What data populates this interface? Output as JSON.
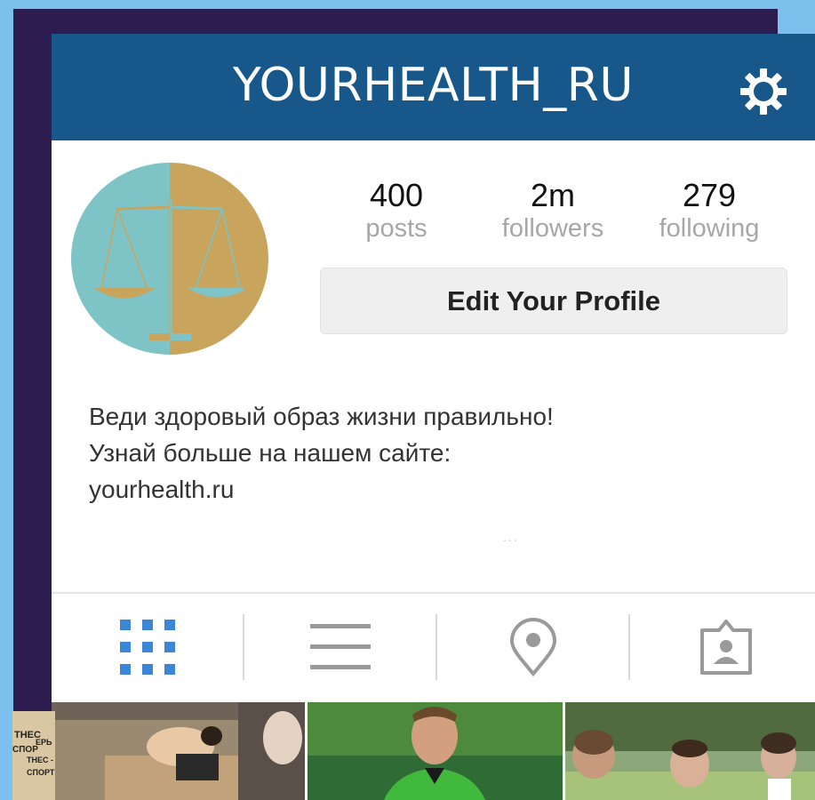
{
  "header": {
    "username": "YOURHEALTH_RU",
    "settings_icon": "gear-icon",
    "bar_color": "#17578a"
  },
  "profile": {
    "avatar_icon": "scales-of-justice-icon",
    "stats": [
      {
        "value": "400",
        "label": "posts"
      },
      {
        "value": "2m",
        "label": "followers"
      },
      {
        "value": "279",
        "label": "following"
      }
    ],
    "edit_button_label": "Edit Your Profile",
    "bio_lines": [
      "Веди здоровый образ жизни правильно!",
      "Узнай больше на нашем сайте:",
      "yourhealth.ru"
    ],
    "more_indicator": "..."
  },
  "tabs": [
    {
      "name": "grid-view",
      "icon": "grid-icon",
      "active": true,
      "color": "#3b86d6"
    },
    {
      "name": "list-view",
      "icon": "list-icon",
      "active": false,
      "color": "#9a9a9a"
    },
    {
      "name": "location",
      "icon": "location-pin-icon",
      "active": false,
      "color": "#9a9a9a"
    },
    {
      "name": "tagged",
      "icon": "tagged-person-icon",
      "active": false,
      "color": "#9a9a9a"
    }
  ],
  "photos": [
    {
      "subject": "fitness-photo",
      "sticker_text": [
        "ТНЕС",
        "ЕРЬ",
        "СПОР",
        "ТНЕС -",
        "СПОРТ"
      ]
    },
    {
      "subject": "soccer-player-photo"
    },
    {
      "subject": "park-exercise-photo"
    }
  ]
}
